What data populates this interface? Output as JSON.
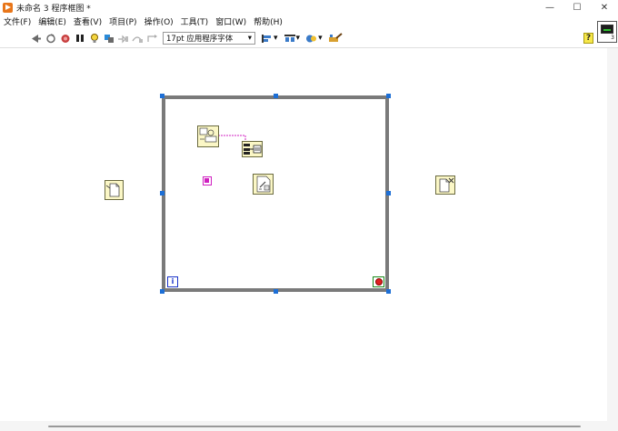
{
  "window": {
    "title": "未命名 3 程序框图 *",
    "minimize_glyph": "—",
    "maximize_glyph": "☐",
    "close_glyph": "✕"
  },
  "menu": {
    "items": [
      {
        "label": "文件(F)"
      },
      {
        "label": "编辑(E)"
      },
      {
        "label": "查看(V)"
      },
      {
        "label": "项目(P)"
      },
      {
        "label": "操作(O)"
      },
      {
        "label": "工具(T)"
      },
      {
        "label": "窗口(W)"
      },
      {
        "label": "帮助(H)"
      }
    ]
  },
  "toolbar": {
    "font_label": "17pt 应用程序字体",
    "buttons": [
      "run-arrow-icon",
      "run-continuous-icon",
      "abort-icon",
      "pause-icon",
      "highlight-execution-icon",
      "retain-wire-values-icon",
      "step-into-icon",
      "step-over-icon",
      "step-out-icon"
    ],
    "dropdowns": [
      "align-objects-icon",
      "distribute-objects-icon",
      "reorder-icon",
      "cleanup-diagram-icon"
    ]
  },
  "vi_icon": {
    "number": "3"
  },
  "help_glyph": "?",
  "loop": {
    "iteration_label": "i"
  },
  "colors": {
    "loop_frame": "#7a7a7a",
    "selection_handle": "#1d6fd6",
    "node_fill": "#fbf7c6",
    "wire_pink": "#d020c0",
    "iteration_blue": "#1a33c9",
    "stop_green": "#1a8a1a"
  }
}
